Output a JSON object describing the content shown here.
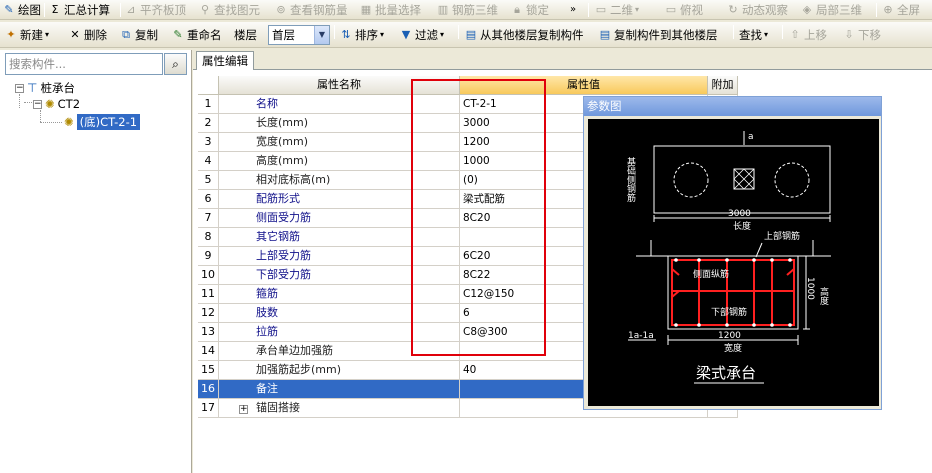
{
  "toolbar1": {
    "items": [
      "绘图",
      "汇总计算",
      "平齐板顶",
      "查找图元",
      "查看钢筋量",
      "批量选择",
      "钢筋三维",
      "锁定",
      "二维",
      "俯视",
      "动态观察",
      "局部三维",
      "全屏"
    ],
    "overflow": "»"
  },
  "toolbar2": {
    "new": "新建",
    "delete": "删除",
    "copy": "复制",
    "rename": "重命名",
    "floor_label": "楼层",
    "floor_value": "首层",
    "sort": "排序",
    "filter": "过滤",
    "copy_from": "从其他楼层复制构件",
    "copy_to": "复制构件到其他楼层",
    "find": "查找",
    "move_up": "上移",
    "move_down": "下移"
  },
  "left": {
    "search_placeholder": "搜索构件...",
    "tree": {
      "root": "桩承台",
      "child": "CT2",
      "leaf": "(底)CT-2-1"
    }
  },
  "editor": {
    "tab": "属性编辑",
    "headers": {
      "name": "属性名称",
      "value": "属性值",
      "extra": "附加"
    },
    "rows": [
      {
        "index": "1",
        "name": "名称",
        "value": "CT-2-1",
        "blue": true
      },
      {
        "index": "2",
        "name": "长度(mm)",
        "value": "3000",
        "blue": false
      },
      {
        "index": "3",
        "name": "宽度(mm)",
        "value": "1200",
        "blue": false
      },
      {
        "index": "4",
        "name": "高度(mm)",
        "value": "1000",
        "blue": false
      },
      {
        "index": "5",
        "name": "相对底标高(m)",
        "value": "(0)",
        "blue": false
      },
      {
        "index": "6",
        "name": "配筋形式",
        "value": "梁式配筋",
        "blue": true
      },
      {
        "index": "7",
        "name": "侧面受力筋",
        "value": "8C20",
        "blue": true
      },
      {
        "index": "8",
        "name": "其它钢筋",
        "value": "",
        "blue": true
      },
      {
        "index": "9",
        "name": "上部受力筋",
        "value": "6C20",
        "blue": true
      },
      {
        "index": "10",
        "name": "下部受力筋",
        "value": "8C22",
        "blue": true
      },
      {
        "index": "11",
        "name": "箍筋",
        "value": "C12@150",
        "blue": true
      },
      {
        "index": "12",
        "name": "肢数",
        "value": "6",
        "blue": true
      },
      {
        "index": "13",
        "name": "拉筋",
        "value": "C8@300",
        "blue": true
      },
      {
        "index": "14",
        "name": "承台单边加强筋",
        "value": "",
        "blue": false
      },
      {
        "index": "15",
        "name": "加强筋起步(mm)",
        "value": "40",
        "blue": false
      },
      {
        "index": "16",
        "name": "备注",
        "value": "",
        "blue": true
      },
      {
        "index": "17",
        "name": "锚固搭接",
        "value": "",
        "blue": false
      }
    ],
    "expand_glyph": "+"
  },
  "diagram": {
    "title": "参数图",
    "labels": {
      "a": "a",
      "side_rebar": "基础侧钢筋",
      "length_val": "3000",
      "length": "长度",
      "top_rebar": "上部钢筋",
      "side_long": "侧面纵筋",
      "height_val": "1000",
      "height": "高度",
      "bottom_rebar": "下部钢筋",
      "section": "1a-1a",
      "width_val": "1200",
      "width": "宽度",
      "caption": "梁式承台"
    }
  }
}
